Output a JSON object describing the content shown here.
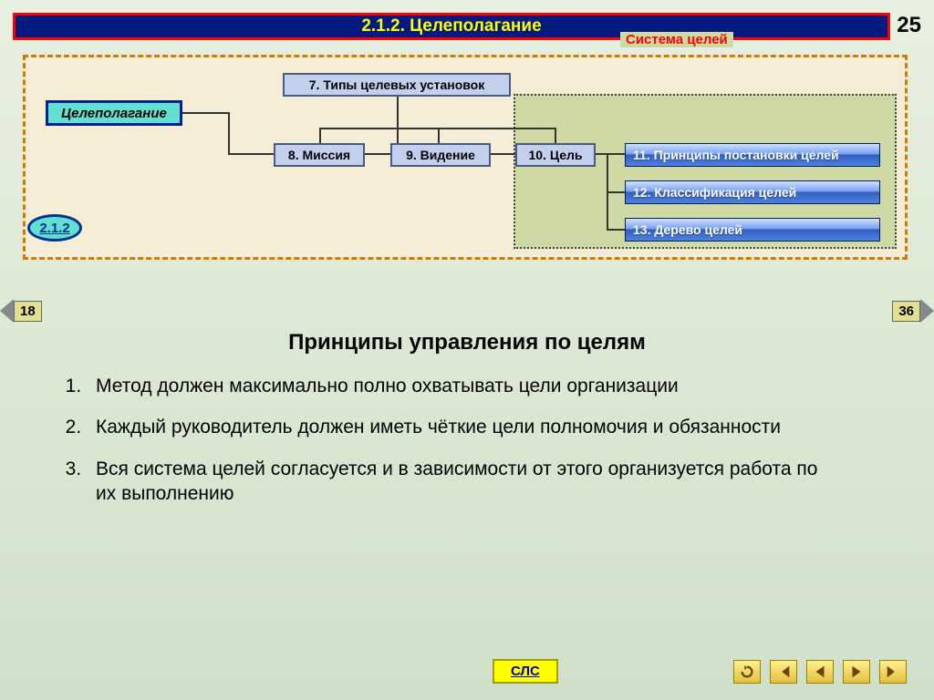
{
  "header": {
    "title": "2.1.2. Целеполагание",
    "slide_number": "25"
  },
  "diagram": {
    "root": "Целеполагание",
    "section_ref": "2.1.2",
    "node_types": "7. Типы целевых установок",
    "node_mission": "8. Миссия",
    "node_vision": "9. Видение",
    "node_goal": "10. Цель",
    "subsystem_label": "Система целей",
    "node_principles": "11. Принципы постановки целей",
    "node_classification": "12. Классификация целей",
    "node_tree": "13. Дерево целей"
  },
  "nav_prev": "18",
  "nav_next": "36",
  "content": {
    "title": "Принципы управления по целям",
    "items": [
      "Метод должен максимально полно охватывать цели организации",
      "Каждый руководитель должен иметь чёткие цели полномочия и обязанности",
      "Вся система целей согласуется и в зависимости от этого организуется работа по их выполнению"
    ]
  },
  "sls_label": "СЛС",
  "bottom_nav_icons": [
    "undo-icon",
    "first-icon",
    "prev-icon",
    "next-icon",
    "last-icon"
  ]
}
